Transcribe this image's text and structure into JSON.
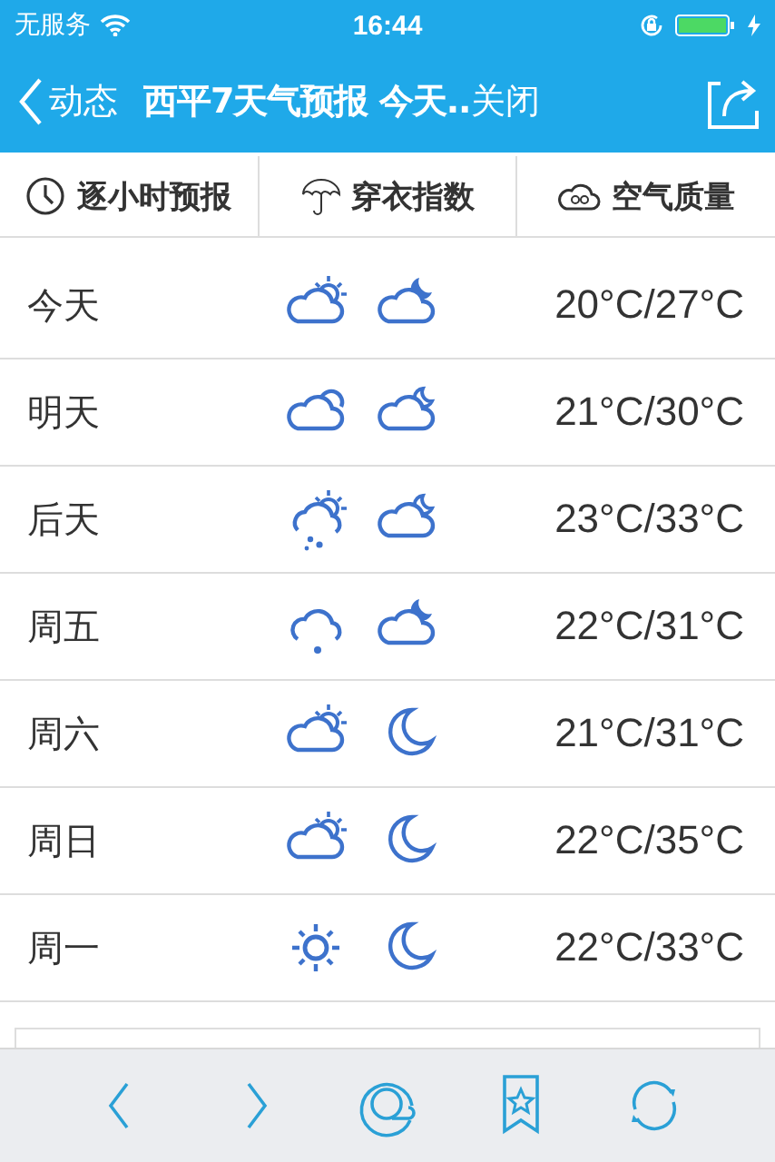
{
  "status_bar": {
    "carrier": "无服务",
    "time": "16:44"
  },
  "nav_bar": {
    "back": "动态",
    "title": "西平7天气预报 今天..",
    "close": "关闭"
  },
  "tabs": [
    {
      "label": "逐小时预报"
    },
    {
      "label": "穿衣指数"
    },
    {
      "label": "空气质量"
    }
  ],
  "forecast": [
    {
      "day": "今天",
      "icons": [
        {
          "kind": "partly-sunny"
        },
        {
          "kind": "cloud-moon-filled"
        }
      ],
      "temp": "20°C/27°C"
    },
    {
      "day": "明天",
      "icons": [
        {
          "kind": "cloudy"
        },
        {
          "kind": "cloud-moon"
        }
      ],
      "temp": "21°C/30°C"
    },
    {
      "day": "后天",
      "icons": [
        {
          "kind": "sun-rain"
        },
        {
          "kind": "cloud-moon"
        }
      ],
      "temp": "23°C/33°C"
    },
    {
      "day": "周五",
      "icons": [
        {
          "kind": "rain"
        },
        {
          "kind": "cloud-moon-filled"
        }
      ],
      "temp": "22°C/31°C"
    },
    {
      "day": "周六",
      "icons": [
        {
          "kind": "partly-sunny"
        },
        {
          "kind": "moon"
        }
      ],
      "temp": "21°C/31°C"
    },
    {
      "day": "周日",
      "icons": [
        {
          "kind": "partly-sunny"
        },
        {
          "kind": "moon"
        }
      ],
      "temp": "22°C/35°C"
    },
    {
      "day": "周一",
      "icons": [
        {
          "kind": "sunny"
        },
        {
          "kind": "moon"
        }
      ],
      "temp": "22°C/33°C"
    }
  ]
}
